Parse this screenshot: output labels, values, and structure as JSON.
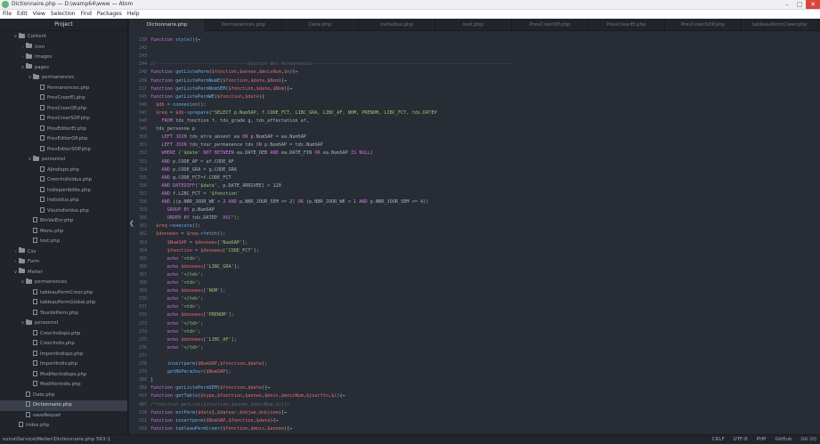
{
  "window": {
    "title": "Dictionnaire.php — D:\\wamp64\\www — Atom"
  },
  "menu": [
    "File",
    "Edit",
    "View",
    "Selection",
    "Find",
    "Packages",
    "Help"
  ],
  "sidebar": {
    "header": "Project",
    "items": [
      {
        "label": "Content",
        "type": "folder",
        "depth": 1,
        "open": true
      },
      {
        "label": "icon",
        "type": "folder",
        "depth": 2,
        "open": false
      },
      {
        "label": "images",
        "type": "folder",
        "depth": 2,
        "open": false
      },
      {
        "label": "pages",
        "type": "folder",
        "depth": 2,
        "open": true
      },
      {
        "label": "permanences",
        "type": "folder",
        "depth": 3,
        "open": true
      },
      {
        "label": "Permanences.php",
        "type": "file",
        "depth": 4
      },
      {
        "label": "PrevCreerEI.php",
        "type": "file",
        "depth": 4
      },
      {
        "label": "PrevCreerOP.php",
        "type": "file",
        "depth": 4
      },
      {
        "label": "PrevCreerSOP.php",
        "type": "file",
        "depth": 4
      },
      {
        "label": "PrevEditerEI.php",
        "type": "file",
        "depth": 4
      },
      {
        "label": "PrevEditerOP.php",
        "type": "file",
        "depth": 4
      },
      {
        "label": "PrevEditerSOP.php",
        "type": "file",
        "depth": 4
      },
      {
        "label": "personnel",
        "type": "folder",
        "depth": 3,
        "open": true
      },
      {
        "label": "AjIndispo.php",
        "type": "file",
        "depth": 4
      },
      {
        "label": "CreerIndividus.php",
        "type": "file",
        "depth": 4
      },
      {
        "label": "Indisponibilite.php",
        "type": "file",
        "depth": 4
      },
      {
        "label": "Individus.php",
        "type": "file",
        "depth": 4
      },
      {
        "label": "VisuIndividus.php",
        "type": "file",
        "depth": 4
      },
      {
        "label": "BtnValEnr.php",
        "type": "file",
        "depth": 3
      },
      {
        "label": "Menu.php",
        "type": "file",
        "depth": 3
      },
      {
        "label": "test.php",
        "type": "file",
        "depth": 3
      },
      {
        "label": "Css",
        "type": "folder",
        "depth": 1,
        "open": false
      },
      {
        "label": "Form",
        "type": "folder",
        "depth": 1,
        "open": false
      },
      {
        "label": "Metier",
        "type": "folder",
        "depth": 1,
        "open": true
      },
      {
        "label": "permanences",
        "type": "folder",
        "depth": 2,
        "open": true
      },
      {
        "label": "tableauPermCreer.php",
        "type": "file",
        "depth": 3
      },
      {
        "label": "tableauPermGlobal.php",
        "type": "file",
        "depth": 3
      },
      {
        "label": "TourdePerm.php",
        "type": "file",
        "depth": 3
      },
      {
        "label": "personnel",
        "type": "folder",
        "depth": 2,
        "open": true
      },
      {
        "label": "CreerIndispo.php",
        "type": "file",
        "depth": 3
      },
      {
        "label": "CreerIndiv.php",
        "type": "file",
        "depth": 3
      },
      {
        "label": "ImportIndispo.php",
        "type": "file",
        "depth": 3
      },
      {
        "label": "ImportIndiv.php",
        "type": "file",
        "depth": 3
      },
      {
        "label": "ModifierIndispo.php",
        "type": "file",
        "depth": 3
      },
      {
        "label": "ModifierIndiv.php",
        "type": "file",
        "depth": 3
      },
      {
        "label": "Date.php",
        "type": "file",
        "depth": 2
      },
      {
        "label": "Dictionnaire.php",
        "type": "file",
        "depth": 2,
        "selected": true
      },
      {
        "label": "saveRequet",
        "type": "file",
        "depth": 2
      },
      {
        "label": "index.php",
        "type": "file",
        "depth": 1
      }
    ]
  },
  "tabs": [
    {
      "label": "Dictionnaire.php",
      "active": true
    },
    {
      "label": "Permanences.php"
    },
    {
      "label": "Date.php"
    },
    {
      "label": "Individus.php"
    },
    {
      "label": "test.php"
    },
    {
      "label": "PrevCreerOP.php"
    },
    {
      "label": "PrevCreerEI.php"
    },
    {
      "label": "PrevCreerSOP.php"
    },
    {
      "label": "tableauPermCreer.php"
    }
  ],
  "editor": {
    "lines": [
      {
        "n": "239",
        "fold": true,
        "code": "function style(){⇔"
      },
      {
        "n": "242",
        "code": ""
      },
      {
        "n": "243",
        "code": ""
      },
      {
        "n": "244",
        "code": "//---------------------------------Gestion des Permanences------------------------------------------------------------------------"
      },
      {
        "n": "245",
        "fold": true,
        "code": "function getListePerm($fonction,$annee,$moisNum,$n){⇔"
      },
      {
        "n": "289",
        "fold": true,
        "code": "function getListePermNumE($fonction,$date,$Nom){⇔"
      },
      {
        "n": "317",
        "fold": true,
        "code": "function getListePermNomSEM($fonction,$date,$Nom){⇔"
      },
      {
        "n": "345",
        "code": "function getListePermWE($fonction,$date){"
      },
      {
        "n": "346",
        "code": "  $db = connexion();"
      },
      {
        "n": "347",
        "code": "  $req = $db->prepare(\"SELECT p.NumSAP, f.CODE_FCT, LIBC_GRA, LIBC_AF, NOM, PRENOM, LIBC_FCT, tds.DATEP"
      },
      {
        "n": "348",
        "code": "    FROM tds_fonction f, tds_grade g, tds_affectation af,"
      },
      {
        "n": "349",
        "code": "  tds_personne p"
      },
      {
        "n": "350",
        "code": "    LEFT JOIN tds_etre_absent ea ON p.NumSAP = ea.NumSAP"
      },
      {
        "n": "351",
        "code": "    LEFT JOIN tds_tour_permanence tds ON p.NumSAP = tds.NumSAP"
      },
      {
        "n": "352",
        "code": "    WHERE ('$date' NOT BETWEEN ea.DATE_DEB AND ea.DATE_FIN OR ea.NumSAP IS NULL)"
      },
      {
        "n": "353",
        "code": "    AND p.CODE_AF = af.CODE_AF"
      },
      {
        "n": "354",
        "code": "    AND p.CODE_GRA = g.CODE_GRA"
      },
      {
        "n": "355",
        "code": "    AND g.CODE_FCT=f.CODE_FCT"
      },
      {
        "n": "356",
        "code": "    AND DATEDIFF('$date', p.DATE_ARRIVEE) > 120"
      },
      {
        "n": "357",
        "code": "    AND f.LIBC_FCT = '$fonction'"
      },
      {
        "n": "358",
        "code": "    AND ((p.NBR_JOUR_WE < 2 AND p.NBR_JOUR_SEM <= 2) OR (p.NBR_JOUR_WE < 1 AND p.NBR_JOUR_SEM <= 4))"
      },
      {
        "n": "359",
        "code": "      GROUP BY p.NumSAP"
      },
      {
        "n": "360",
        "code": "      ORDER BY tds.DATEP  ASC\");"
      },
      {
        "n": "361",
        "code": "  $req->execute();"
      },
      {
        "n": "362",
        "code": "  $donnees = $req->fetch();"
      },
      {
        "n": "363",
        "code": "      $NumSAP = $donnees['NumSAP'];"
      },
      {
        "n": "364",
        "code": "      $fonction = $donnees['CODE_FCT'];"
      },
      {
        "n": "365",
        "code": "      echo '<td>';"
      },
      {
        "n": "366",
        "code": "      echo $donnees['LIBC_GRA'];"
      },
      {
        "n": "367",
        "code": "      echo '</td>';"
      },
      {
        "n": "368",
        "code": "      echo '<td>';"
      },
      {
        "n": "369",
        "code": "      echo $donnees['NOM'];"
      },
      {
        "n": "370",
        "code": "      echo '</td>';"
      },
      {
        "n": "371",
        "code": "      echo '<td>';"
      },
      {
        "n": "372",
        "code": "      echo $donnees['PRENOM'];"
      },
      {
        "n": "373",
        "code": "      echo '</td>';"
      },
      {
        "n": "374",
        "code": "      echo '<td>';"
      },
      {
        "n": "375",
        "code": "      echo $donnees['LIBC_AF'];"
      },
      {
        "n": "376",
        "code": "      echo '</td>';"
      },
      {
        "n": "377",
        "code": ""
      },
      {
        "n": "378",
        "code": "      insertperm($NumSAP,$fonction,$date);"
      },
      {
        "n": "379",
        "code": "      getNbPermJour($NumSAP);"
      },
      {
        "n": "380",
        "code": "}"
      },
      {
        "n": "381",
        "fold": true,
        "code": "function getListePermSEM($fonction,$date){⇔"
      },
      {
        "n": "417",
        "fold": true,
        "code": "function getTable($type,$fonction,$annee,$mois,$moisNum,$jourfin,$i){⇔"
      },
      {
        "n": "487",
        "fold": true,
        "code": "/*function getList($fonction,$annee,$moisNum,$n){⇔"
      },
      {
        "n": "518",
        "fold": true,
        "code": "function extPerm($date],$datear,$nbjwe,$nbjsem){⇔"
      },
      {
        "n": "551",
        "fold": true,
        "code": "function insertperm($NumSAP,$fonction,$date){⇔"
      },
      {
        "n": "563",
        "fold": true,
        "code": "function tableauPermCreer($fonction,$mois,$annee){⇔"
      }
    ]
  },
  "statusbar": {
    "path": "extra\\Service\\Metier\\Dictionnaire.php",
    "cursor": "563:1",
    "line_ending": "CRLF",
    "encoding": "UTF-8",
    "grammar": "PHP",
    "github": "GitHub",
    "git": "Git (0)"
  }
}
